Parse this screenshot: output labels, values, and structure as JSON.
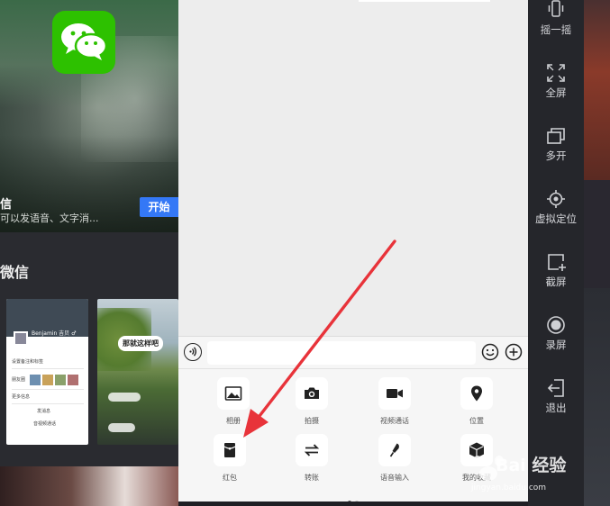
{
  "left_panel": {
    "hero_title": "信",
    "hero_desc": "可以发语音、文字消...",
    "start_button": "开始",
    "section_title": "微信",
    "thumb1": {
      "name": "Benjamin 吉贝 ♂",
      "rows": [
        "设置备注和标签",
        "朋友圈",
        "更多信息",
        "发消息",
        "音视频通话"
      ]
    },
    "thumb2": {
      "bubble": "那就这样吧"
    }
  },
  "phone": {
    "input_placeholder": "",
    "panel_items": [
      {
        "icon": "photo-icon",
        "label": "相册"
      },
      {
        "icon": "camera-icon",
        "label": "拍摄"
      },
      {
        "icon": "video-call-icon",
        "label": "视频通话"
      },
      {
        "icon": "location-icon",
        "label": "位置"
      },
      {
        "icon": "red-packet-icon",
        "label": "红包"
      },
      {
        "icon": "transfer-icon",
        "label": "转账"
      },
      {
        "icon": "microphone-icon",
        "label": "语音输入"
      },
      {
        "icon": "favorites-icon",
        "label": "我的收藏"
      }
    ]
  },
  "toolbar": {
    "items": [
      {
        "icon": "shake-icon",
        "label": "摇一摇"
      },
      {
        "icon": "fullscreen-icon",
        "label": "全屏"
      },
      {
        "icon": "multi-open-icon",
        "label": "多开"
      },
      {
        "icon": "virtual-location-icon",
        "label": "虚拟定位"
      },
      {
        "icon": "screenshot-icon",
        "label": "截屏"
      },
      {
        "icon": "record-icon",
        "label": "录屏"
      },
      {
        "icon": "exit-icon",
        "label": "退出"
      }
    ]
  },
  "watermark": {
    "text": "Bai 经验",
    "sub": "jingyan.baidu.com"
  },
  "colors": {
    "wechat_green": "#2dc100",
    "start_blue": "#3478f6",
    "arrow_red": "#e8333a"
  }
}
